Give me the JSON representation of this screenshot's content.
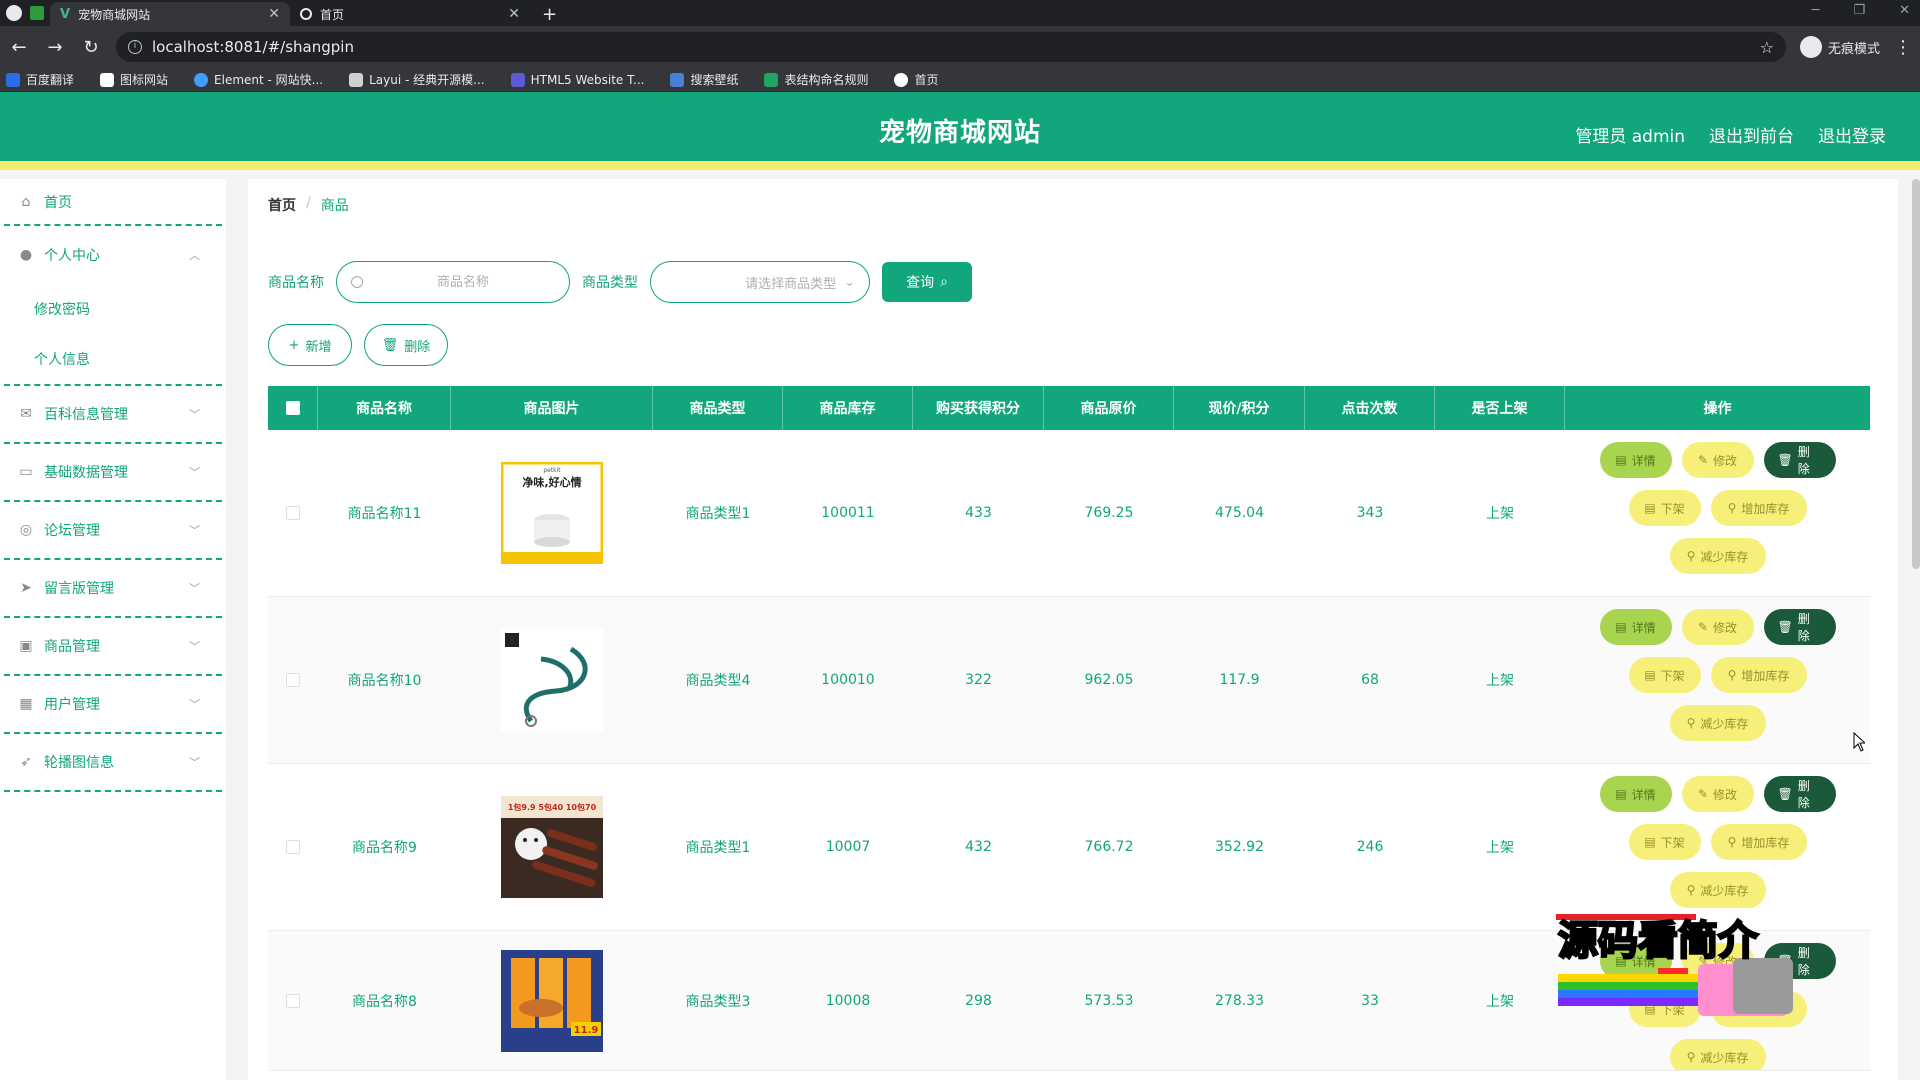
{
  "browser": {
    "tabs": [
      {
        "title": "宠物商城网站",
        "active": true
      },
      {
        "title": "首页",
        "active": false
      }
    ],
    "url": "localhost:8081/#/shangpin",
    "profile": "无痕模式",
    "bookmarks": [
      {
        "label": "百度翻译",
        "color": "#2b6de8"
      },
      {
        "label": "图标网站",
        "color": "#ffffff"
      },
      {
        "label": "Element - 网站快...",
        "color": "#409eff"
      },
      {
        "label": "Layui - 经典开源模...",
        "color": "#d0d0d0"
      },
      {
        "label": "HTML5 Website T...",
        "color": "#5b5bd6"
      },
      {
        "label": "搜索壁纸",
        "color": "#4a7fd6"
      },
      {
        "label": "表结构命名规则",
        "color": "#1fa463"
      },
      {
        "label": "首页",
        "color": "#ffffff"
      }
    ]
  },
  "header": {
    "title": "宠物商城网站",
    "admin": "管理员 admin",
    "to_front": "退出到前台",
    "logout": "退出登录"
  },
  "sidebar": {
    "items": [
      {
        "label": "首页",
        "icon": "home-icon"
      },
      {
        "label": "个人中心",
        "icon": "user-icon",
        "expanded": true,
        "children": [
          "修改密码",
          "个人信息"
        ]
      },
      {
        "label": "百科信息管理",
        "icon": "mail-icon"
      },
      {
        "label": "基础数据管理",
        "icon": "message-icon"
      },
      {
        "label": "论坛管理",
        "icon": "compass-icon"
      },
      {
        "label": "留言版管理",
        "icon": "send-icon"
      },
      {
        "label": "商品管理",
        "icon": "goods-icon"
      },
      {
        "label": "用户管理",
        "icon": "grid-icon"
      },
      {
        "label": "轮播图信息",
        "icon": "location-icon"
      }
    ]
  },
  "breadcrumb": {
    "home": "首页",
    "sep": "/",
    "current": "商品"
  },
  "search": {
    "name_label": "商品名称",
    "name_placeholder": "商品名称",
    "type_label": "商品类型",
    "type_placeholder": "请选择商品类型",
    "query_button": "查询"
  },
  "actions": {
    "add": "新增",
    "delete": "删除"
  },
  "table": {
    "headers": [
      "商品名称",
      "商品图片",
      "商品类型",
      "商品库存",
      "购买获得积分",
      "商品原价",
      "现价/积分",
      "点击次数",
      "是否上架",
      "操作"
    ],
    "rows": [
      {
        "name": "商品名称11",
        "type": "商品类型1",
        "stock": "100011",
        "points": "433",
        "orig": "769.25",
        "price": "475.04",
        "clicks": "343",
        "status": "上架",
        "image": "product-image-purifier"
      },
      {
        "name": "商品名称10",
        "type": "商品类型4",
        "stock": "100010",
        "points": "322",
        "orig": "962.05",
        "price": "117.9",
        "clicks": "68",
        "status": "上架",
        "image": "product-image-leash"
      },
      {
        "name": "商品名称9",
        "type": "商品类型1",
        "stock": "10007",
        "points": "432",
        "orig": "766.72",
        "price": "352.92",
        "clicks": "246",
        "status": "上架",
        "image": "product-image-dog-treats"
      },
      {
        "name": "商品名称8",
        "type": "商品类型3",
        "stock": "10008",
        "points": "298",
        "orig": "573.53",
        "price": "278.33",
        "clicks": "33",
        "status": "上架",
        "image": "product-image-jerky"
      }
    ],
    "ops": {
      "detail": "详情",
      "edit": "修改",
      "delete": "删除",
      "off_shelf": "下架",
      "add_stock": "增加库存",
      "reduce_stock": "减少库存"
    }
  },
  "product_images": {
    "purifier_brand": "petkit",
    "purifier_caption": "净味,好心情",
    "dog_treats_badge": "1包9.9 5包40 10包70",
    "jerky_price": "11.9"
  },
  "watermark": "源码看简介"
}
